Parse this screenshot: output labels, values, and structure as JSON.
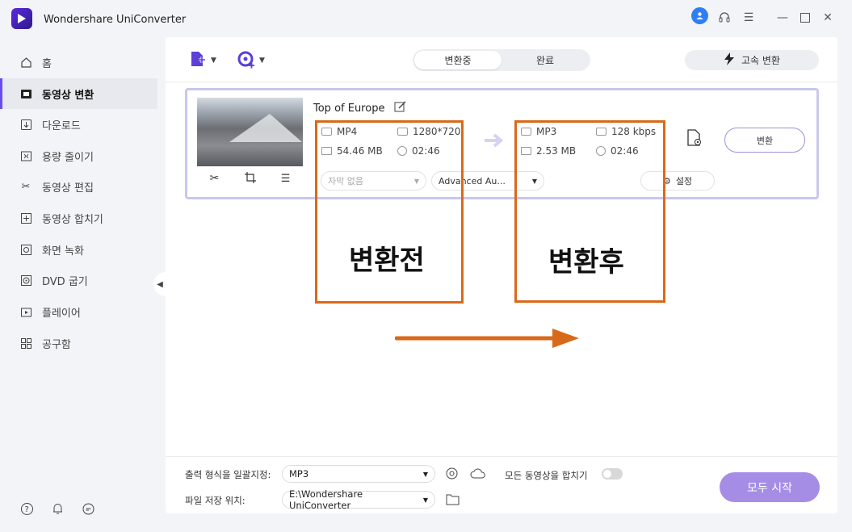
{
  "app": {
    "title": "Wondershare UniConverter"
  },
  "sidebar": {
    "items": [
      {
        "label": "홈",
        "icon": "home-icon"
      },
      {
        "label": "동영상 변환",
        "icon": "convert-icon",
        "active": true
      },
      {
        "label": "다운로드",
        "icon": "download-icon"
      },
      {
        "label": "용량 줄이기",
        "icon": "compress-icon"
      },
      {
        "label": "동영상 편집",
        "icon": "scissors-icon"
      },
      {
        "label": "동영상 합치기",
        "icon": "merge-icon"
      },
      {
        "label": "화면 녹화",
        "icon": "record-icon"
      },
      {
        "label": "DVD 굽기",
        "icon": "dvd-icon"
      },
      {
        "label": "플레이어",
        "icon": "player-icon"
      },
      {
        "label": "공구함",
        "icon": "toolbox-icon"
      }
    ]
  },
  "tabs": {
    "converting": "변환중",
    "done": "완료"
  },
  "fast_convert": "고속 변환",
  "file": {
    "name": "Top of Europe",
    "source": {
      "format": "MP4",
      "resolution": "1280*720",
      "size": "54.46 MB",
      "duration": "02:46"
    },
    "target": {
      "format": "MP3",
      "bitrate": "128 kbps",
      "size": "2.53 MB",
      "duration": "02:46"
    },
    "subtitle": "자막 없음",
    "audio": "Advanced Au...",
    "settings": "설정",
    "convert": "변환"
  },
  "annotations": {
    "before": "변환전",
    "after": "변환후",
    "color": "#d9691a"
  },
  "bottom": {
    "format_label": "출력 형식을 일괄지정:",
    "format_value": "MP3",
    "path_label": "파일 저장 위치:",
    "path_value": "E:\\Wondershare UniConverter",
    "merge_label": "모든 동영상을 합치기",
    "start": "모두 시작"
  }
}
